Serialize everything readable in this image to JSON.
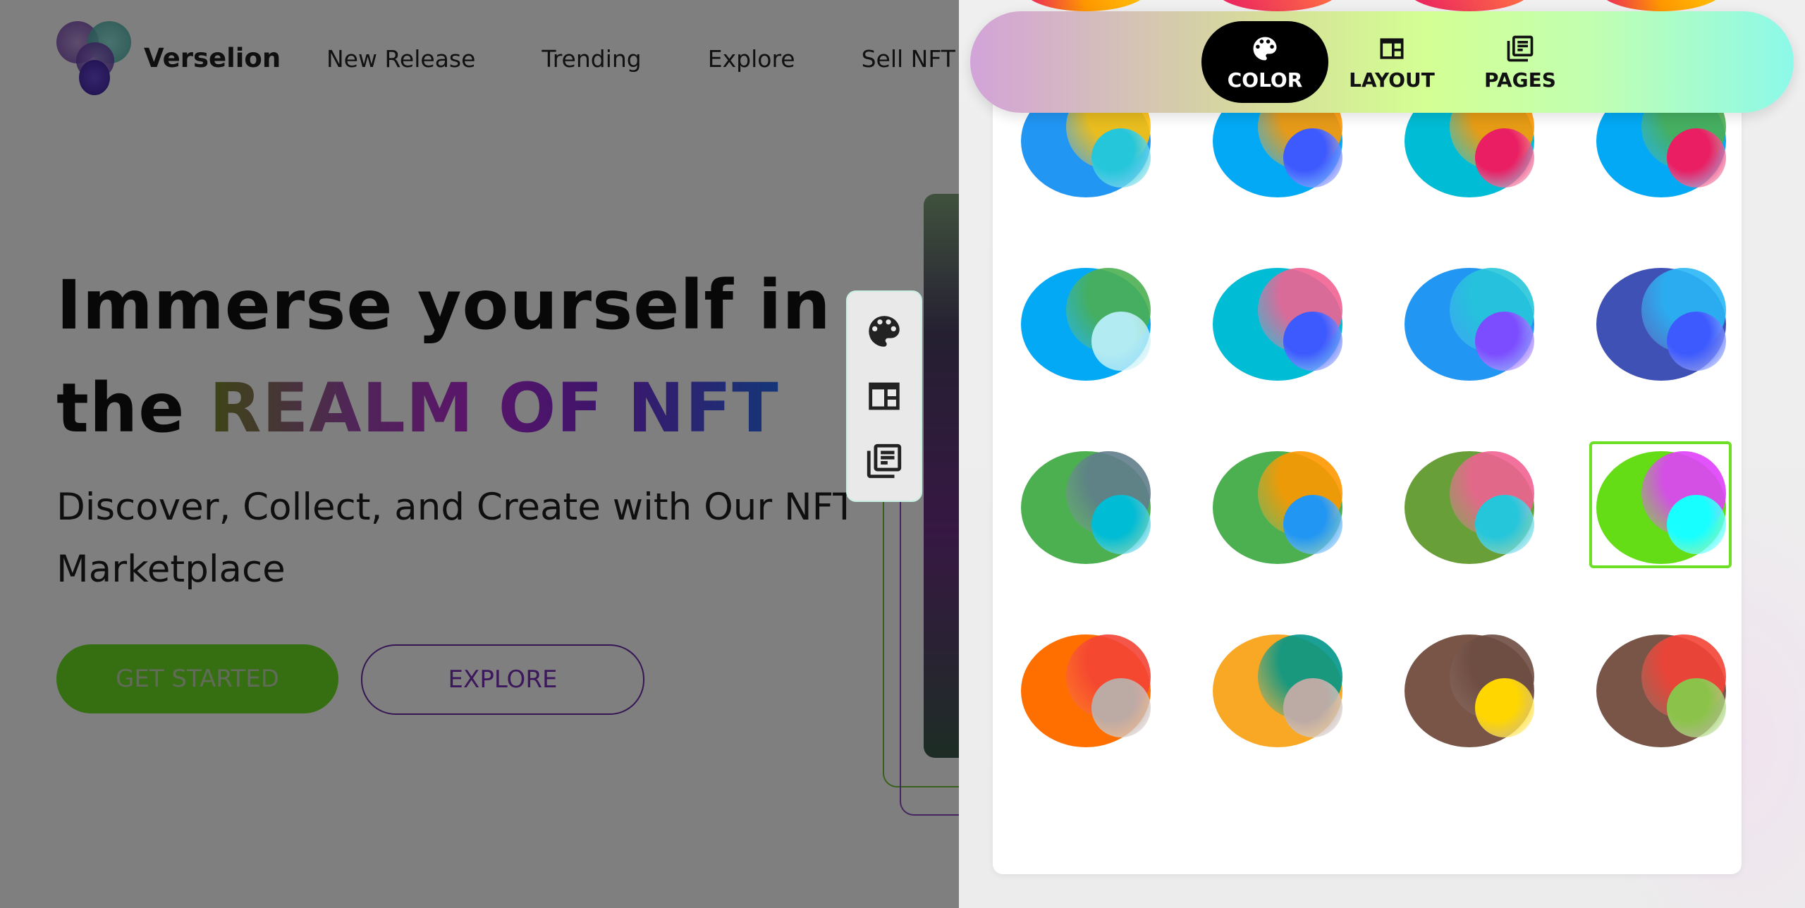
{
  "site": {
    "brand_name": "Verselion",
    "nav": [
      "New Release",
      "Trending",
      "Explore",
      "Sell NFT"
    ],
    "hero": {
      "title_line1": "Immerse yourself in",
      "title_line2_prefix": "the ",
      "title_line2_highlight": "REALM OF NFT",
      "subtitle": "Discover, Collect, and Create with Our NFT Marketplace",
      "primary_button": "GET STARTED",
      "secondary_button": "EXPLORE"
    }
  },
  "toolstrip": {
    "items": [
      {
        "name": "palette-icon"
      },
      {
        "name": "layout-icon"
      },
      {
        "name": "pages-icon"
      }
    ]
  },
  "drawer": {
    "tabs": [
      {
        "label": "COLOR",
        "icon": "palette-icon",
        "active": true
      },
      {
        "label": "LAYOUT",
        "icon": "layout-icon",
        "active": false
      },
      {
        "label": "PAGES",
        "icon": "pages-icon",
        "active": false
      }
    ],
    "swatches": [
      {
        "base": "#2196f3",
        "mid": "#ffc107",
        "small": "#26c6da"
      },
      {
        "base": "#03a9f4",
        "mid": "#ff9800",
        "small": "#3d5afe"
      },
      {
        "base": "#00bcd4",
        "mid": "#ff9800",
        "small": "#e91e63"
      },
      {
        "base": "#03a9f4",
        "mid": "#4caf50",
        "small": "#e91e63"
      },
      {
        "base": "#03a9f4",
        "mid": "#4caf50",
        "small": "#b2ebf2"
      },
      {
        "base": "#00bcd4",
        "mid": "#f06292",
        "small": "#3d5afe"
      },
      {
        "base": "#2196f3",
        "mid": "#26c6da",
        "small": "#7c4dff"
      },
      {
        "base": "#3f51b5",
        "mid": "#29b6f6",
        "small": "#3d5afe"
      },
      {
        "base": "#4caf50",
        "mid": "#607d8b",
        "small": "#00bcd4"
      },
      {
        "base": "#4caf50",
        "mid": "#ff9800",
        "small": "#2196f3"
      },
      {
        "base": "#689f38",
        "mid": "#f06292",
        "small": "#26c6da"
      },
      {
        "base": "#64dd17",
        "mid": "#e040fb",
        "small": "#18ffff",
        "selected": true
      },
      {
        "base": "#ff6f00",
        "mid": "#f44336",
        "small": "#bcaaa4"
      },
      {
        "base": "#f9a825",
        "mid": "#009688",
        "small": "#bcaaa4"
      },
      {
        "base": "#795548",
        "mid": "#6d4c41",
        "small": "#ffd600"
      },
      {
        "base": "#795548",
        "mid": "#f44336",
        "small": "#8bc34a"
      }
    ],
    "selected_color": "#6adf23"
  }
}
